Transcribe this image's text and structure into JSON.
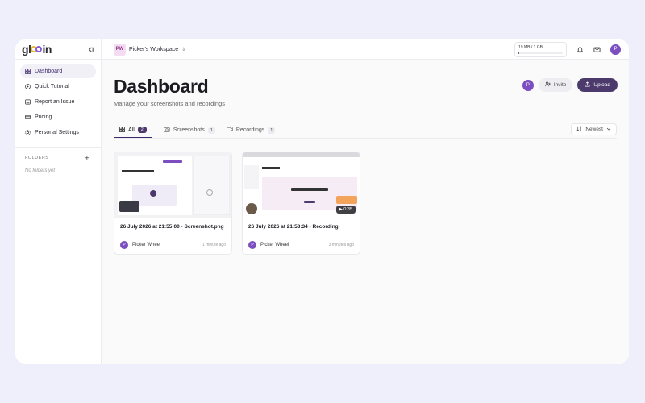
{
  "app": {
    "logo": "glooin"
  },
  "sidebar": {
    "items": [
      {
        "label": "Dashboard",
        "icon": "grid-icon",
        "active": true
      },
      {
        "label": "Quick Tutorial",
        "icon": "play-circle-icon"
      },
      {
        "label": "Report an Issue",
        "icon": "inbox-icon"
      },
      {
        "label": "Pricing",
        "icon": "credit-card-icon"
      },
      {
        "label": "Personal Settings",
        "icon": "gear-icon"
      }
    ],
    "folders_label": "FOLDERS",
    "folders_add": "+",
    "no_folders": "No folders yet"
  },
  "topbar": {
    "workspace_initials": "PW",
    "workspace_name": "Picker's Workspace",
    "storage_label": "19 MB / 1 GB",
    "storage_fraction": 0.019,
    "user_initial": "P"
  },
  "main": {
    "title": "Dashboard",
    "subtitle": "Manage your screenshots and recordings",
    "actions": {
      "avatar_initial": "P",
      "invite": "Invite",
      "upload": "Upload"
    },
    "tabs": [
      {
        "label": "All",
        "count": "2",
        "active": true
      },
      {
        "label": "Screenshots",
        "count": "1"
      },
      {
        "label": "Recordings",
        "count": "1"
      }
    ],
    "sort_label": "Newest",
    "cards": [
      {
        "title": "26 July 2026 at 21:55:00 - Screenshot.png",
        "owner_initial": "P",
        "owner": "Picker Wheel",
        "time": "1 minute ago"
      },
      {
        "title": "26 July 2026 at 21:53:34 - Recording",
        "owner_initial": "P",
        "owner": "Picker Wheel",
        "time": "3 minutes ago",
        "duration": "0:35"
      }
    ]
  },
  "colors": {
    "accent": "#4b3a6b",
    "avatar": "#7b4fbf",
    "background": "#efeefb"
  }
}
